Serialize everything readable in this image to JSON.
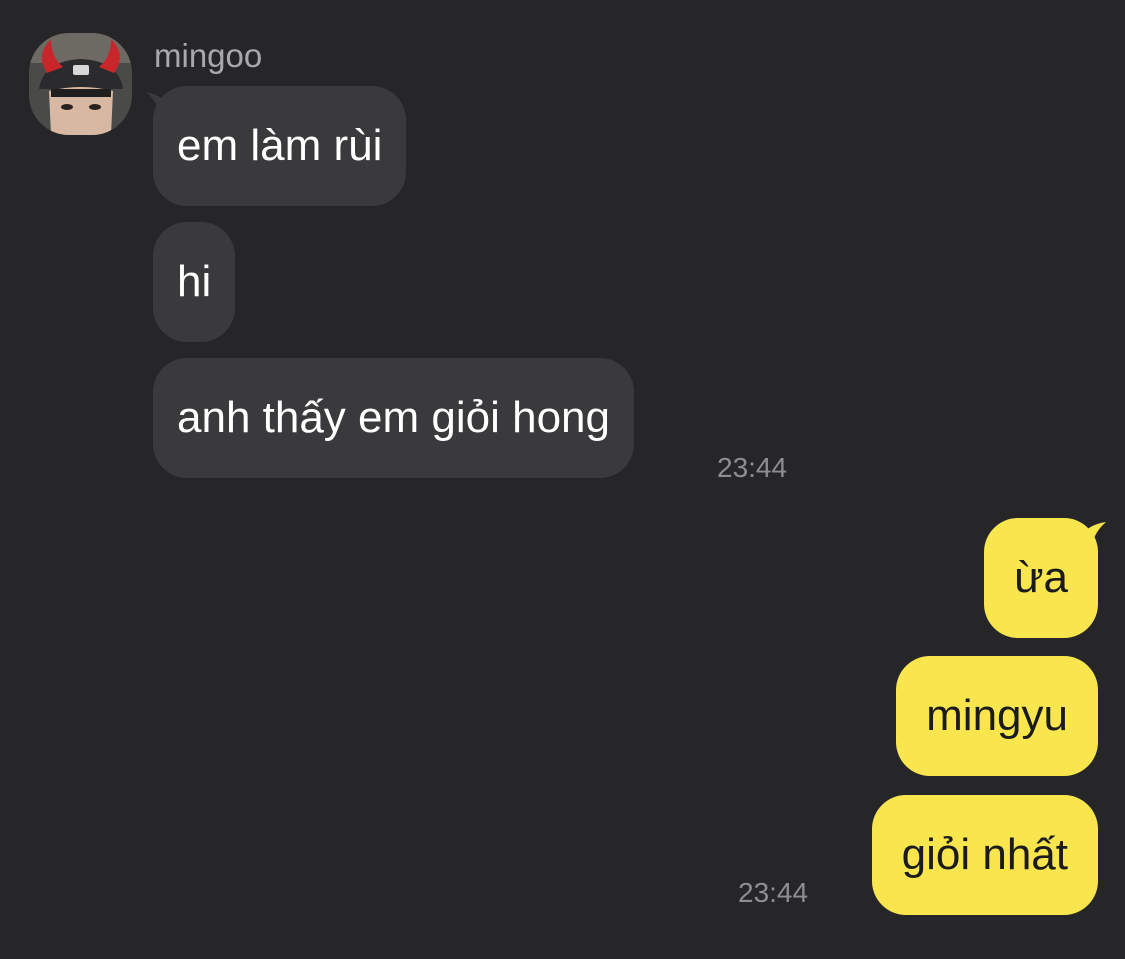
{
  "chat": {
    "sender_name": "mingoo",
    "incoming": [
      {
        "text": "em làm rùi"
      },
      {
        "text": "hi"
      },
      {
        "text": "anh thấy em giỏi hong"
      }
    ],
    "incoming_time": "23:44",
    "outgoing": [
      {
        "text": "ừa"
      },
      {
        "text": "mingyu"
      },
      {
        "text": "giỏi nhất"
      }
    ],
    "outgoing_time": "23:44"
  },
  "colors": {
    "background": "#262628",
    "incoming_bubble": "#3a3a3c",
    "outgoing_bubble": "#f9e54e",
    "incoming_text": "#ffffff",
    "outgoing_text": "#1b1b1b",
    "meta_text": "#8d8d92"
  },
  "icons": {
    "avatar": "profile-photo-avatar"
  }
}
